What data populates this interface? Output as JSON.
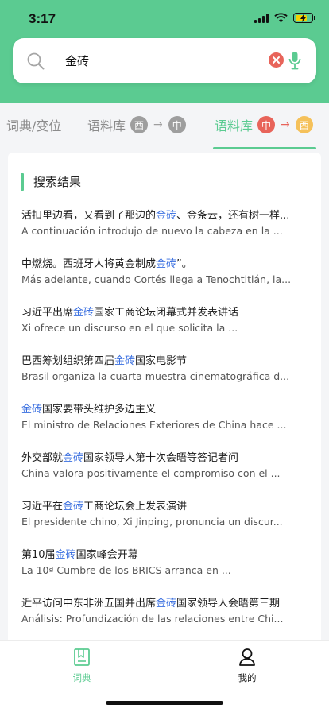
{
  "status": {
    "time": "3:17"
  },
  "search": {
    "query": "金砖"
  },
  "tabs": {
    "dict": "词典/变位",
    "corpus1_label": "语料库",
    "corpus1_from": "西",
    "corpus1_to": "中",
    "corpus2_label": "语料库",
    "corpus2_from": "中",
    "corpus2_to": "西"
  },
  "section": {
    "title": "搜索结果"
  },
  "results": [
    {
      "zh_pre": "活扣里边看，又看到了那边的",
      "hl": "金砖",
      "zh_post": "、金条云，还有树一样...",
      "es": "A continuación introdujo de nuevo la cabeza en la ..."
    },
    {
      "zh_pre": "中燃烧。西班牙人将黄金制成",
      "hl": "金砖",
      "zh_post": "”。",
      "es": "Más adelante, cuando Cortés llega a Tenochtitlán, la..."
    },
    {
      "zh_pre": "习近平出席",
      "hl": "金砖",
      "zh_post": "国家工商论坛闭幕式并发表讲话",
      "es": " Xi ofrece un discurso en el que solicita la ..."
    },
    {
      "zh_pre": "巴西筹划组织第四届",
      "hl": "金砖",
      "zh_post": "国家电影节",
      "es": " Brasil organiza la cuarta muestra cinematográfica d..."
    },
    {
      "zh_pre": "",
      "hl": "金砖",
      "zh_post": "国家要带头维护多边主义",
      "es": " El ministro de Relaciones Exteriores de China hace ..."
    },
    {
      "zh_pre": "外交部就",
      "hl": "金砖",
      "zh_post": "国家领导人第十次会晤等答记者问",
      "es": " China valora positivamente el compromiso con el ..."
    },
    {
      "zh_pre": "习近平在",
      "hl": "金砖",
      "zh_post": "工商论坛会上发表演讲",
      "es": " El presidente chino, Xi Jinping, pronuncia un discur..."
    },
    {
      "zh_pre": "第10届",
      "hl": "金砖",
      "zh_post": "国家峰会开幕",
      "es": " La 10ª Cumbre de los BRICS arranca en ..."
    },
    {
      "zh_pre": "近平访问中东非洲五国并出席",
      "hl": "金砖",
      "zh_post": "国家领导人会晤第三期",
      "es": " Análisis: Profundización de las relaciones entre Chi..."
    }
  ],
  "nav": {
    "dict": "词典",
    "mine": "我的"
  },
  "colors": {
    "accent": "#5bcb91",
    "highlight": "#3a6fe0",
    "badge_red": "#e8645a",
    "badge_gray": "#9e9e9e",
    "badge_yellow": "#f5c15a"
  }
}
